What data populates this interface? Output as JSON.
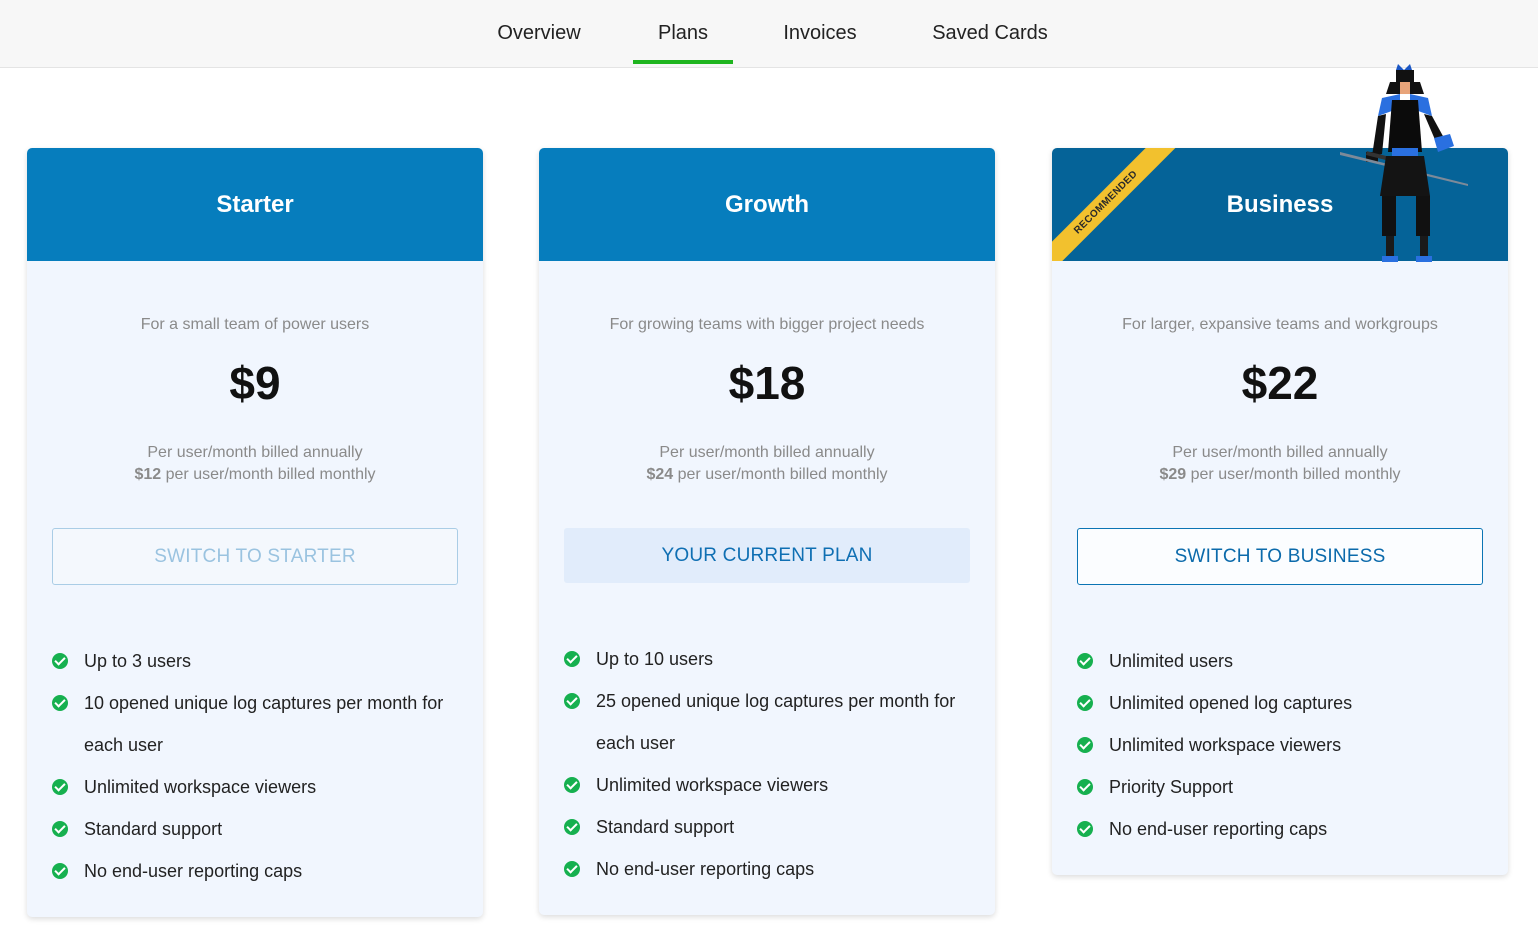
{
  "nav": {
    "tabs": [
      {
        "label": "Overview"
      },
      {
        "label": "Plans"
      },
      {
        "label": "Invoices"
      },
      {
        "label": "Saved Cards"
      }
    ],
    "active_tab": "Plans",
    "active_color": "#1fb51f"
  },
  "colors": {
    "header_blue": "#067dbd",
    "business_header": "#056398",
    "card_bg": "#f1f6fe",
    "check_green": "#16b04f",
    "ribbon_yellow": "#f2c12e"
  },
  "plans": [
    {
      "title": "Starter",
      "description": "For a small team of power users",
      "price": "$9",
      "billing_line1": "Per user/month billed annually",
      "monthly_price": "$12",
      "billing_line2": " per user/month billed monthly",
      "button_label": "SWITCH TO STARTER",
      "features": [
        "Up to 3 users",
        "10 opened unique log captures per month for each user",
        "Unlimited workspace viewers",
        "Standard support",
        "No end-user reporting caps"
      ]
    },
    {
      "title": "Growth",
      "description": "For growing teams with bigger project needs",
      "price": "$18",
      "billing_line1": "Per user/month billed annually",
      "monthly_price": "$24",
      "billing_line2": " per user/month billed monthly",
      "button_label": "YOUR CURRENT PLAN",
      "features": [
        "Up to 10 users",
        "25 opened unique log captures per month for each user",
        "Unlimited workspace viewers",
        "Standard support",
        "No end-user reporting caps"
      ]
    },
    {
      "title": "Business",
      "ribbon": "RECOMMENDED",
      "description": "For larger, expansive teams and workgroups",
      "price": "$22",
      "billing_line1": "Per user/month billed annually",
      "monthly_price": "$29",
      "billing_line2": " per user/month billed monthly",
      "button_label": "SWITCH TO BUSINESS",
      "features": [
        "Unlimited users",
        "Unlimited opened log captures",
        "Unlimited workspace viewers",
        "Priority Support",
        "No end-user reporting caps"
      ]
    }
  ]
}
